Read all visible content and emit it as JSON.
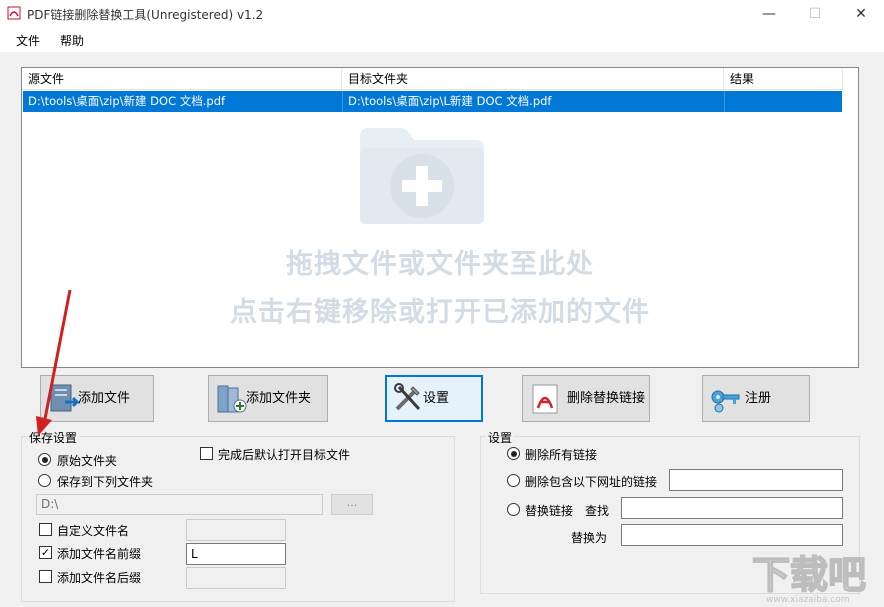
{
  "window": {
    "title": "PDF链接删除替换工具(Unregistered) v1.2",
    "minimize_glyph": "—",
    "maximize_glyph": "☐",
    "close_glyph": "✕"
  },
  "menu": {
    "items": [
      "文件",
      "帮助"
    ]
  },
  "file_list": {
    "columns": [
      "源文件",
      "目标文件夹",
      "结果"
    ],
    "rows": [
      {
        "source": "D:\\tools\\桌面\\zip\\新建 DOC 文档.pdf",
        "target": "D:\\tools\\桌面\\zip\\L新建 DOC 文档.pdf",
        "result": ""
      }
    ],
    "hint_line1": "拖拽文件或文件夹至此处",
    "hint_line2": "点击右键移除或打开已添加的文件",
    "selected_color": "#0078d7"
  },
  "toolbar": {
    "add_file": "添加文件",
    "add_folder": "添加文件夹",
    "settings": "设置",
    "delete_replace": "删除替换链接",
    "register": "注册"
  },
  "save_settings": {
    "title": "保存设置",
    "original_folder": "原始文件夹",
    "save_to_folder": "保存到下列文件夹",
    "open_after": "完成后默认打开目标文件",
    "folder_path": "D:\\",
    "browse": "...",
    "custom_name": "自定义文件名",
    "custom_name_value": "",
    "add_prefix": "添加文件名前缀",
    "prefix_value": "L",
    "add_suffix": "添加文件名后缀",
    "suffix_value": "",
    "selected_option": "original_folder",
    "open_after_checked": false,
    "custom_name_checked": false,
    "prefix_checked": true,
    "suffix_checked": false
  },
  "link_settings": {
    "title": "设置",
    "delete_all": "删除所有链接",
    "delete_containing": "删除包含以下网址的链接",
    "replace": "替换链接",
    "find": "查找",
    "replace_with": "替换为",
    "url_value": "",
    "find_value": "",
    "replace_value": "",
    "selected_option": "delete_all"
  },
  "watermark": {
    "text": "下载吧",
    "sub": "www.xiazaiba.com"
  }
}
